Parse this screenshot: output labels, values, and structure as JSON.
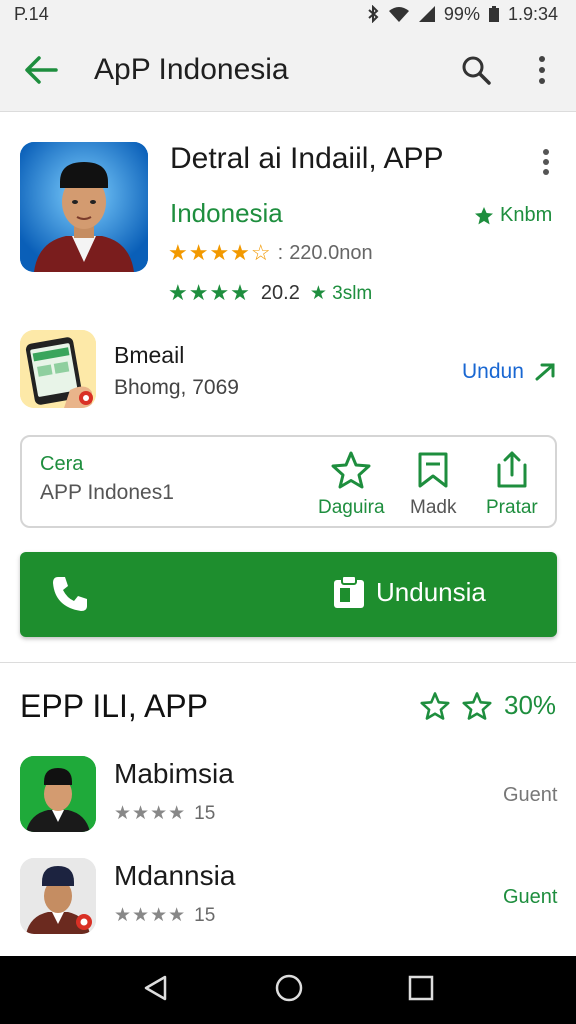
{
  "status_bar": {
    "time_left": "P.14",
    "battery_pct": "99%",
    "clock": "1.9:34"
  },
  "app_bar": {
    "title": "ApP Indonesia",
    "icons": [
      "back-arrow-icon",
      "search-icon",
      "overflow-menu-icon"
    ]
  },
  "app_header": {
    "title": "Detral ai Indaiil, APP",
    "developer": "Indonesia",
    "badge": "Knbm",
    "rating": {
      "stars": 3.5,
      "count_text": "220.0non"
    },
    "rating2": {
      "stars": 4,
      "value": "20.2",
      "extra": "3slm"
    }
  },
  "promo": {
    "title": "Bmeail",
    "subtitle": "Bhomg, 7069",
    "action": "Undun"
  },
  "action_card": {
    "title": "Cera",
    "subtitle": "APP Indones1",
    "buttons": [
      {
        "label": "Daguira",
        "icon": "star-outline-icon",
        "color": "#1e8e3e"
      },
      {
        "label": "Madk",
        "icon": "bookmark-icon",
        "color": "#555555"
      },
      {
        "label": "Pratar",
        "icon": "share-icon",
        "color": "#1e8e3e"
      }
    ]
  },
  "install_button": {
    "label": "Undunsia"
  },
  "section": {
    "title": "EPP ILI, APP",
    "right_text": "30%"
  },
  "list": [
    {
      "title": "Mabimsia",
      "rating_text": "15",
      "right": "Guent",
      "right_color": "#777777"
    },
    {
      "title": "Mdannsia",
      "rating_text": "15",
      "right": "Guent",
      "right_color": "#1e8e3e"
    }
  ],
  "colors": {
    "accent_green": "#1e8e2e",
    "link_blue": "#1967d2",
    "star_orange": "#f29900"
  }
}
